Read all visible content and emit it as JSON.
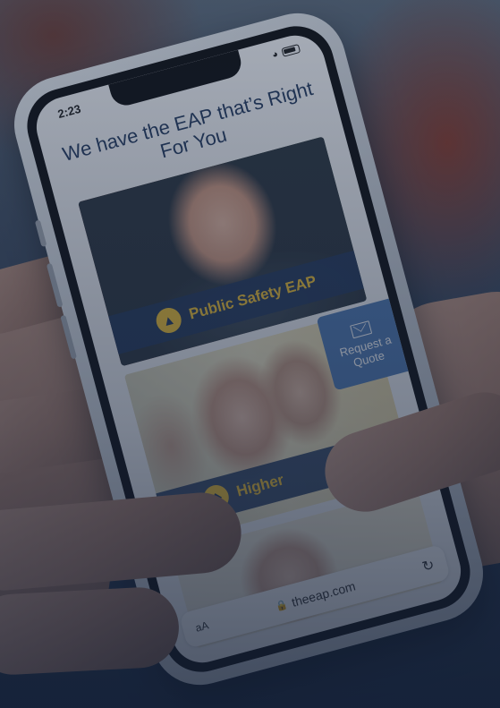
{
  "status_bar": {
    "time": "2:23"
  },
  "page": {
    "heading": "We have the EAP that’s Right For You",
    "cards": [
      {
        "label": "Public Safety EAP",
        "icon": "fire-hydrant-icon"
      },
      {
        "label": "Higher",
        "icon": "graduation-cap-icon"
      }
    ],
    "request_quote": {
      "label": "Request a Quote",
      "icon": "envelope-icon"
    }
  },
  "browser": {
    "text_size_label": "aA",
    "url": "theeap.com",
    "reload_icon": "reload-icon"
  },
  "colors": {
    "navy": "#23395d",
    "gold": "#f1c232",
    "quote_blue": "#4f7ab3"
  }
}
